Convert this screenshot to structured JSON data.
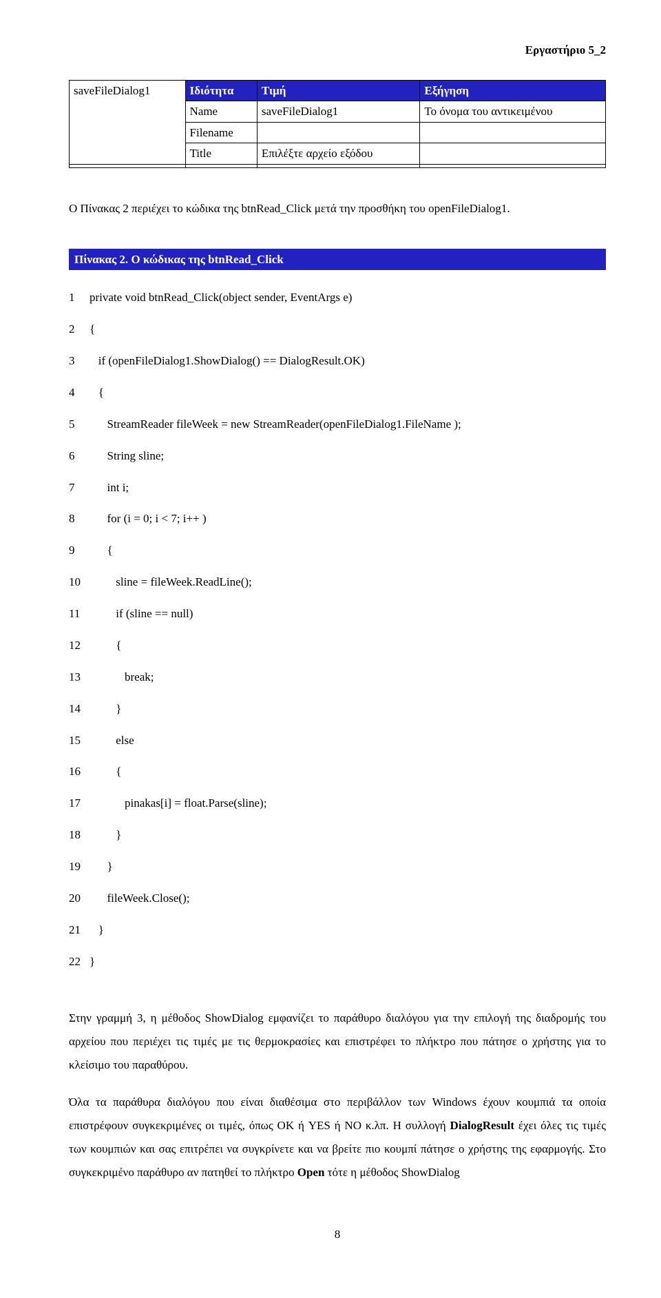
{
  "header": "Εργαστήριο 5_2",
  "table1": {
    "r0c0": "saveFileDialog1",
    "r0c1": "Ιδιότητα",
    "r0c2": "Τιμή",
    "r0c3": "Εξήγηση",
    "r1c1": "Name",
    "r1c2": "saveFileDialog1",
    "r1c3": "Το όνομα του αντικειμένου",
    "r2c1": "Filename",
    "r2c2": "",
    "r2c3": "",
    "r3c1": "Title",
    "r3c2": "Επιλέξτε αρχείο εξόδου",
    "r3c3": ""
  },
  "intro_para": "Ο Πίνακας 2 περιέχει το κώδικα της btnRead_Click μετά την προσθήκη του openFileDialog1.",
  "pinakas2_title": "Πίνακας 2. Ο κώδικας της btnRead_Click",
  "code": {
    "l1": "private void btnRead_Click(object sender, EventArgs e)",
    "l2": "{",
    "l3": "   if (openFileDialog1.ShowDialog() == DialogResult.OK)",
    "l4": "   {",
    "l5": "      StreamReader fileWeek = new StreamReader(openFileDialog1.FileName );",
    "l6": "      String sline;",
    "l7": "      int i;",
    "l8": "      for (i = 0; i < 7; i++ )",
    "l9": "      {",
    "l10": "         sline = fileWeek.ReadLine();",
    "l11": "         if (sline == null)",
    "l12": "         {",
    "l13": "            break;",
    "l14": "         }",
    "l15": "         else",
    "l16": "         {",
    "l17": "            pinakas[i] = float.Parse(sline);",
    "l18": "         }",
    "l19": "      }",
    "l20": "      fileWeek.Close();",
    "l21": "   }",
    "l22": "}"
  },
  "para1": "Στην γραμμή 3, η μέθοδος ShowDialog εμφανίζει το παράθυρο διαλόγου για την επιλογή της διαδρομής του αρχείου που περιέχει τις τιμές με τις θερμοκρασίες και επιστρέφει το πλήκτρο που πάτησε ο χρήστης για το κλείσιμο του παραθύρου.",
  "para2_a": "Όλα τα παράθυρα διαλόγου  που είναι διαθέσιμα στο περιβάλλον των Windows έχουν κουμπιά τα οποία επιστρέφουν  συγκεκριμένες οι τιμές, όπως OK ή YES ή NO κ.λπ. Η συλλογή ",
  "para2_b": "DialogResult",
  "para2_c": " έχει όλες τις τιμές των κουμπιών και σας επιτρέπει να συγκρίνετε και να βρείτε πιο κουμπί πάτησε ο χρήστης της εφαρμογής. Στο συγκεκριμένο παράθυρο αν πατηθεί το πλήκτρο ",
  "para2_d": "Open",
  "para2_e": " τότε η μέθοδος ShowDialog",
  "page_num": "8"
}
